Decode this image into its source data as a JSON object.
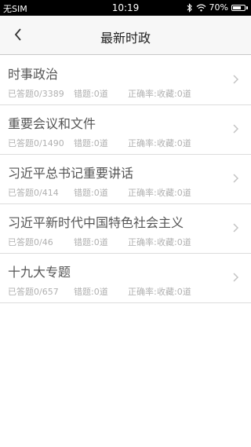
{
  "status_bar": {
    "carrier": "无SIM",
    "time": "10:19",
    "battery": "70%",
    "battery_level": 0.7,
    "icons": [
      "bluetooth-icon",
      "wifi-icon",
      "battery-icon"
    ]
  },
  "nav": {
    "title": "最新时政",
    "back_icon": "chevron-left-icon"
  },
  "items": [
    {
      "name": "时事政治",
      "answered": "已答题0/3389",
      "wrong": "错题:0道",
      "accuracy": "正确率:",
      "collected": "收藏:0道"
    },
    {
      "name": "重要会议和文件",
      "answered": "已答题0/1490",
      "wrong": "错题:0道",
      "accuracy": "正确率:",
      "collected": "收藏:0道"
    },
    {
      "name": "习近平总书记重要讲话",
      "answered": "已答题0/414",
      "wrong": "错题:0道",
      "accuracy": "正确率:",
      "collected": "收藏:0道"
    },
    {
      "name": "习近平新时代中国特色社会主义",
      "answered": "已答题0/46",
      "wrong": "错题:0道",
      "accuracy": "正确率:",
      "collected": "收藏:0道"
    },
    {
      "name": "十九大专题",
      "answered": "已答题0/657",
      "wrong": "错题:0道",
      "accuracy": "正确率:",
      "collected": "收藏:0道"
    }
  ]
}
